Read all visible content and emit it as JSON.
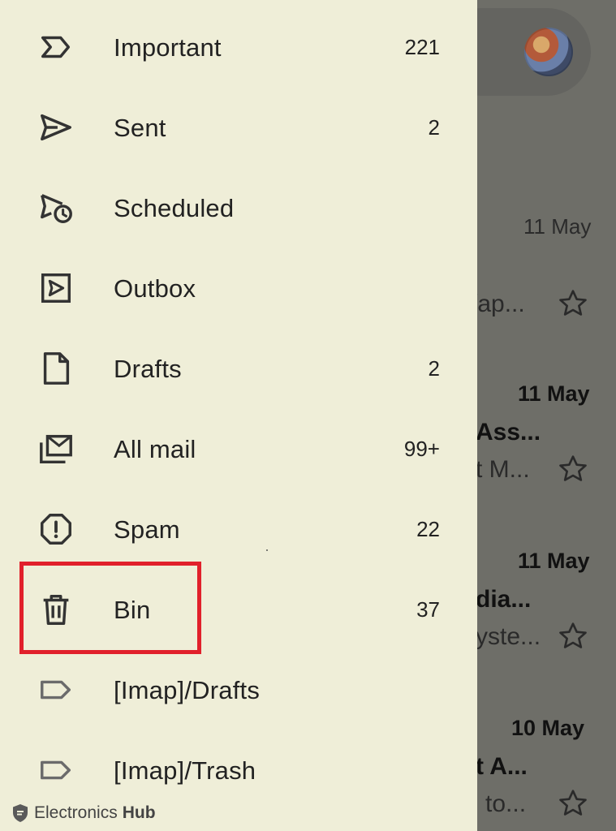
{
  "drawer": {
    "items": [
      {
        "label": "Important",
        "count": "221",
        "icon": "important-icon"
      },
      {
        "label": "Sent",
        "count": "2",
        "icon": "send-icon"
      },
      {
        "label": "Scheduled",
        "count": "",
        "icon": "scheduled-icon"
      },
      {
        "label": "Outbox",
        "count": "",
        "icon": "outbox-icon"
      },
      {
        "label": "Drafts",
        "count": "2",
        "icon": "draft-icon"
      },
      {
        "label": "All mail",
        "count": "99+",
        "icon": "all-mail-icon"
      },
      {
        "label": "Spam",
        "count": "22",
        "icon": "spam-icon"
      },
      {
        "label": "Bin",
        "count": "37",
        "icon": "trash-icon"
      },
      {
        "label": "[Imap]/Drafts",
        "count": "",
        "icon": "label-icon"
      },
      {
        "label": "[Imap]/Trash",
        "count": "",
        "icon": "label-icon"
      }
    ]
  },
  "inbox": {
    "rows": [
      {
        "date": "11 May",
        "subject": "",
        "snippet": "/ap..."
      },
      {
        "date": "11 May",
        "subject": "Ass...",
        "snippet": "t M..."
      },
      {
        "date": "11 May",
        "subject": "dia...",
        "snippet": "yste..."
      },
      {
        "date": "10 May",
        "subject": "t A...",
        "snippet": "to..."
      }
    ]
  },
  "watermark": {
    "name": "Electronics",
    "hub": "Hub"
  },
  "colors": {
    "drawer_bg": "#efeed8",
    "scrim": "#6e6e68",
    "highlight": "#e1202b"
  }
}
